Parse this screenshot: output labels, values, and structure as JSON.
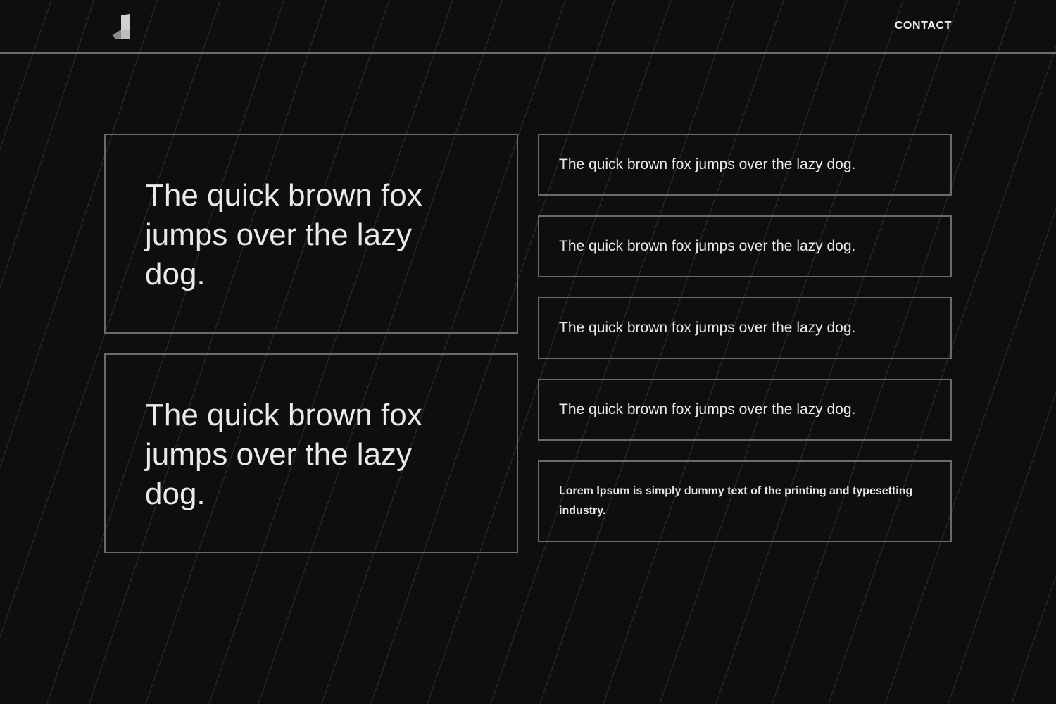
{
  "header": {
    "logo_icon": "logo-mark-icon",
    "contact_label": "CONTACT"
  },
  "main": {
    "large_cards": [
      {
        "text": "The quick brown fox jumps over the lazy dog."
      },
      {
        "text": "The quick brown fox jumps over the lazy dog."
      }
    ],
    "small_cards": [
      {
        "text": "The quick brown fox jumps over the lazy dog."
      },
      {
        "text": "The quick brown fox jumps over the lazy dog."
      },
      {
        "text": "The quick brown fox jumps over the lazy dog."
      },
      {
        "text": "The quick brown fox jumps over the lazy dog."
      }
    ],
    "lorem_card": {
      "text": "Lorem Ipsum is simply dummy text of the printing and typesetting industry."
    }
  },
  "colors": {
    "background": "#0e0e0e",
    "border": "#6b6b6b",
    "text": "#eaeaea"
  }
}
